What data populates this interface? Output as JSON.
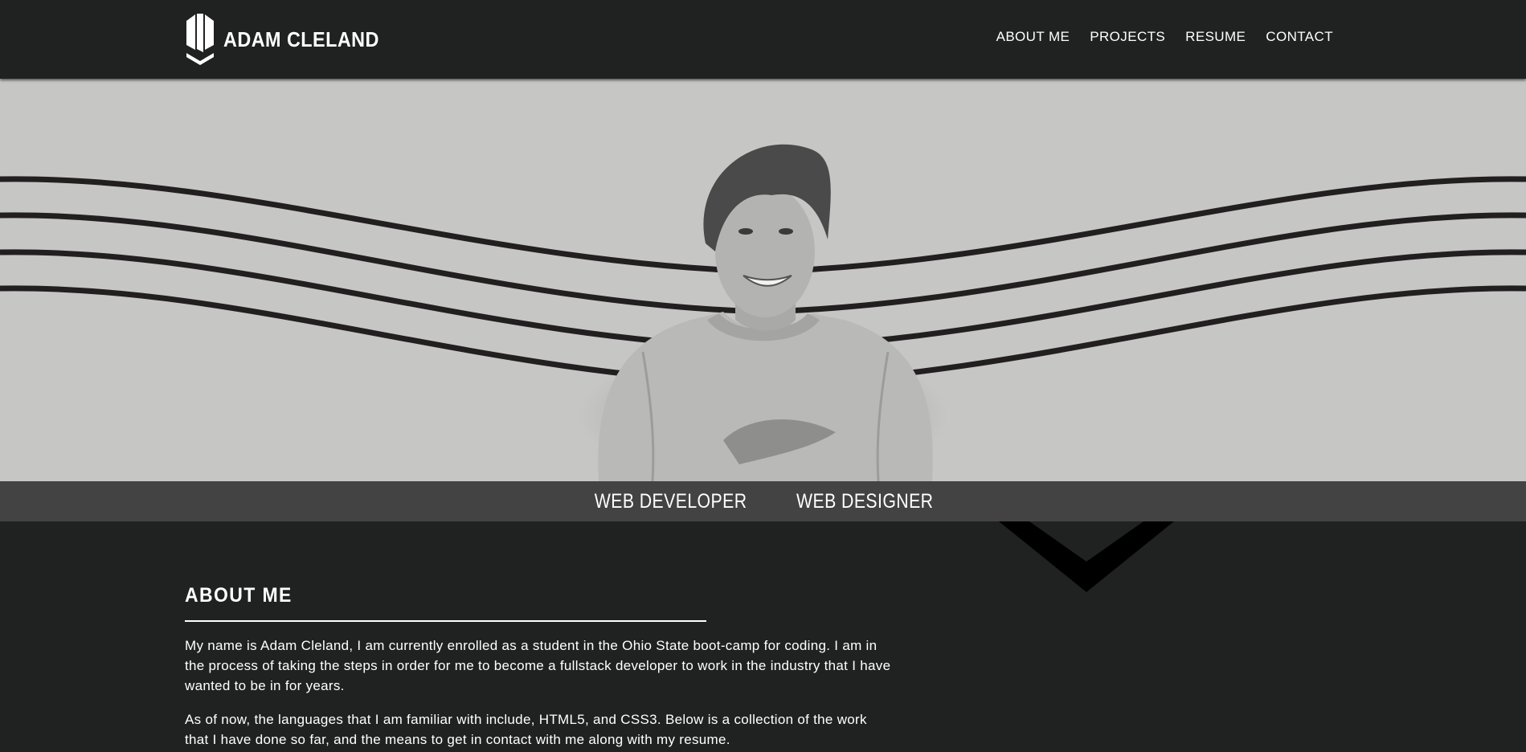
{
  "header": {
    "brand_name": "ADAM CLELAND",
    "logo_icon": "shield-logo-icon",
    "nav": [
      {
        "label": "ABOUT ME"
      },
      {
        "label": "PROJECTS"
      },
      {
        "label": "RESUME"
      },
      {
        "label": "CONTACT"
      }
    ]
  },
  "hero": {
    "roles": [
      "WEB DEVELOPER",
      "WEB DESIGNER"
    ],
    "portrait": "grayscale-portrait-photo",
    "scroll_icon": "chevron-down-icon"
  },
  "about": {
    "heading": "ABOUT ME",
    "paragraphs": [
      "My name is Adam Cleland, I am currently enrolled as a student in the Ohio State boot-camp for coding. I am in the process of taking the steps in order for me to become a fullstack developer to work in the industry that I have wanted to be in for years.",
      "As of now, the languages that I am familiar with include, HTML5, and CSS3. Below is a collection of the work that I have done so far, and the means to get in contact with me along with my resume."
    ]
  },
  "colors": {
    "page_bg": "#202222",
    "hero_bg": "#c6c6c4",
    "tagline_bg": "#434343",
    "text": "#ffffff"
  }
}
